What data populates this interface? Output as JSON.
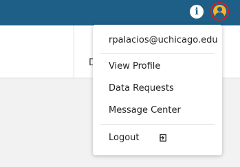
{
  "header": {
    "info_icon_glyph": "i",
    "bar_color": "#1d5f86",
    "highlight_color": "#e11b1b"
  },
  "panel": {
    "partial_label": "D"
  },
  "user_menu": {
    "email": "rpalacios@uchicago.edu",
    "items": [
      {
        "label": "View Profile"
      },
      {
        "label": "Data Requests"
      },
      {
        "label": "Message Center"
      }
    ],
    "logout_label": "Logout",
    "logout_icon": "logout-icon"
  }
}
